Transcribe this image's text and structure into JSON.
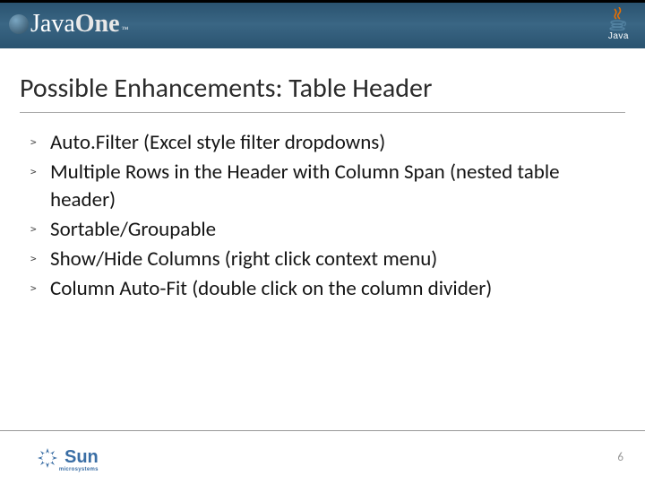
{
  "header": {
    "logo_main": "Java",
    "logo_accent": "One",
    "logo_tm": "™",
    "right_brand": "Java"
  },
  "slide": {
    "title": "Possible Enhancements: Table Header",
    "bullets": [
      "Auto.Filter (Excel style filter dropdowns)",
      "Multiple Rows in the Header with Column Span (nested table header)",
      "Sortable/Groupable",
      "Show/Hide Columns (right click context menu)",
      "Column Auto-Fit (double click on the column divider)"
    ]
  },
  "footer": {
    "sun_label": "Sun",
    "sun_sub": "microsystems",
    "page_number": "6"
  }
}
